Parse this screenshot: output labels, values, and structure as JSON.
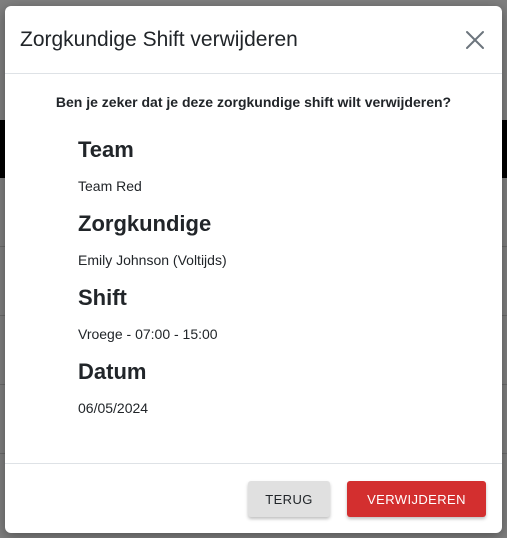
{
  "modal": {
    "title": "Zorgkundige Shift verwijderen",
    "question": "Ben je zeker dat je deze zorgkundige shift wilt verwijderen?",
    "details": [
      {
        "heading": "Team",
        "value": "Team Red"
      },
      {
        "heading": "Zorgkundige",
        "value": "Emily Johnson (Voltijds)"
      },
      {
        "heading": "Shift",
        "value": "Vroege - 07:00 - 15:00"
      },
      {
        "heading": "Datum",
        "value": "06/05/2024"
      }
    ],
    "back_label": "TERUG",
    "delete_label": "VERWIJDEREN"
  },
  "colors": {
    "delete_button": "#d32f2f",
    "back_button": "#e0e0e0",
    "overlay": "#7f7f7f"
  }
}
